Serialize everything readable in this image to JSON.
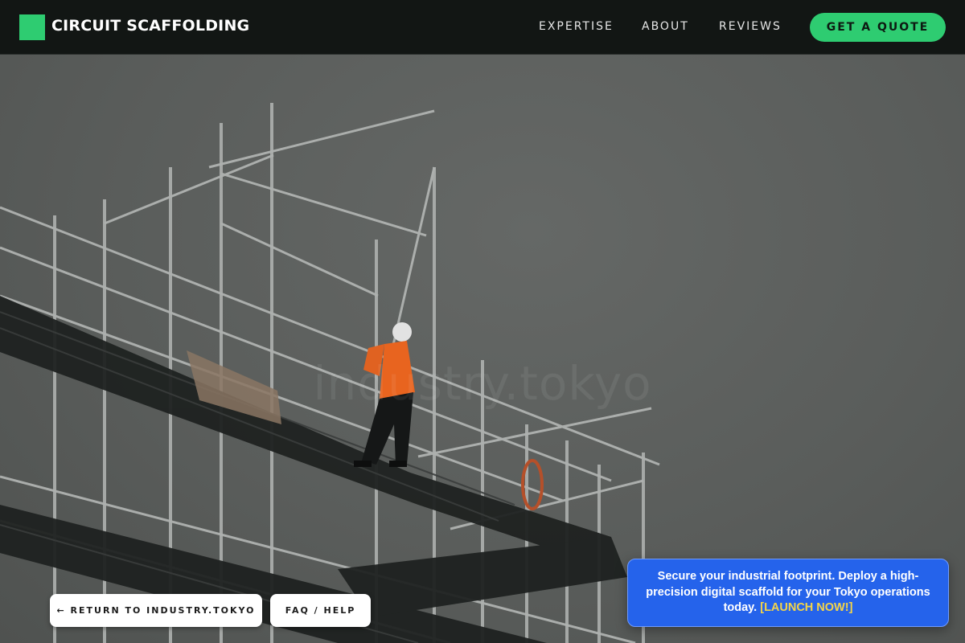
{
  "header": {
    "brand": "CIRCUIT SCAFFOLDING",
    "nav": [
      "EXPERTISE",
      "ABOUT",
      "REVIEWS"
    ],
    "cta": "GET A QUOTE"
  },
  "hero": {
    "watermark": "industry.tokyo"
  },
  "footer_buttons": {
    "return_label": "← RETURN TO INDUSTRY.TOKYO",
    "faq_label": "FAQ / HELP"
  },
  "promo": {
    "text": "Secure your industrial footprint. Deploy a high-precision digital scaffold for your Tokyo operations today.",
    "cta": "[LAUNCH NOW!]"
  },
  "colors": {
    "brand_green": "#2ecc71",
    "header_bg": "#121614",
    "promo_blue": "#2563eb",
    "promo_cta": "#f5d547"
  },
  "icons": {
    "logo": "green-square-logo-icon"
  }
}
